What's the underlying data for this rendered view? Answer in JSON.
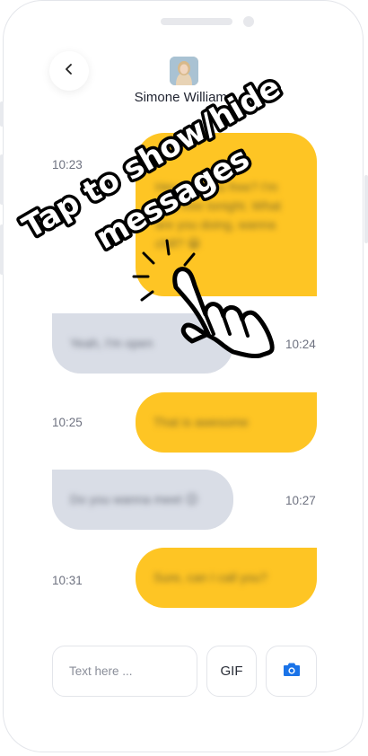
{
  "contact": {
    "name": "Simone Williams"
  },
  "messages": [
    {
      "time": "10:23",
      "side": "right",
      "text": "Hey, are you free? I'm only free tonight. What are you doing, wanna chill? 😀"
    },
    {
      "time": "10:24",
      "side": "left",
      "text": "Yeah, I'm open"
    },
    {
      "time": "10:25",
      "side": "right",
      "text": "That is awesome"
    },
    {
      "time": "10:27",
      "side": "left",
      "text": "Do you wanna meet 😉"
    },
    {
      "time": "10:31",
      "side": "right",
      "text": "Sure, can I call you?"
    }
  ],
  "composer": {
    "placeholder": "Text here ...",
    "gif_label": "GIF"
  },
  "overlay": {
    "line1": "Tap to show/hide",
    "line2": "messages"
  },
  "colors": {
    "sent_bubble": "#fec524",
    "received_bubble": "#d9dde6",
    "accent": "#1a73e8"
  },
  "icons": {
    "back": "chevron-left-icon",
    "camera": "camera-icon",
    "hand": "tap-hand-icon"
  }
}
